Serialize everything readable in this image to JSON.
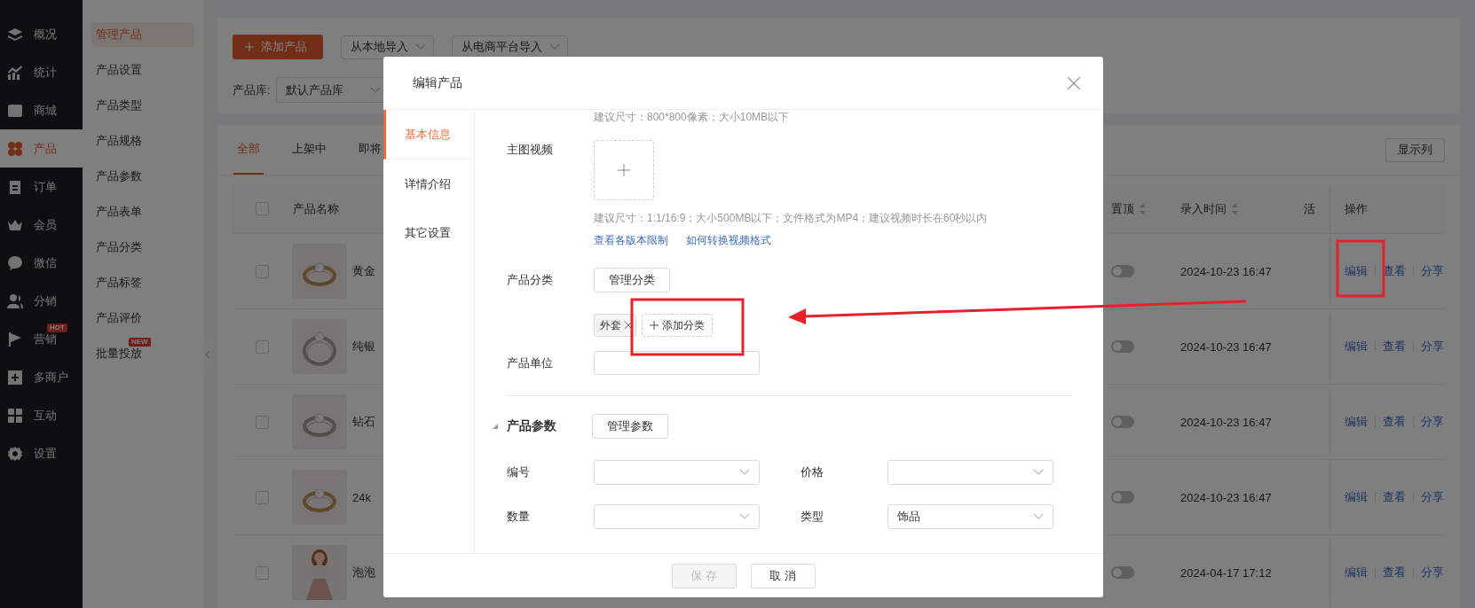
{
  "nav": [
    {
      "label": "概况",
      "selected": false
    },
    {
      "label": "统计",
      "selected": false
    },
    {
      "label": "商城",
      "selected": false
    },
    {
      "label": "产品",
      "selected": true
    },
    {
      "label": "订单",
      "selected": false
    },
    {
      "label": "会员",
      "selected": false
    },
    {
      "label": "微信",
      "selected": false
    },
    {
      "label": "分销",
      "selected": false
    },
    {
      "label": "营销",
      "selected": false,
      "badge": "HOT"
    },
    {
      "label": "多商户",
      "selected": false
    },
    {
      "label": "互动",
      "selected": false
    },
    {
      "label": "设置",
      "selected": false
    }
  ],
  "subnav": [
    {
      "label": "管理产品",
      "selected": true
    },
    {
      "label": "产品设置",
      "selected": false
    },
    {
      "label": "产品类型",
      "selected": false
    },
    {
      "label": "产品规格",
      "selected": false
    },
    {
      "label": "产品参数",
      "selected": false
    },
    {
      "label": "产品表单",
      "selected": false
    },
    {
      "label": "产品分类",
      "selected": false
    },
    {
      "label": "产品标签",
      "selected": false
    },
    {
      "label": "产品评价",
      "selected": false
    },
    {
      "label": "批量投放",
      "selected": false,
      "badge": "NEW"
    }
  ],
  "toolbar": {
    "add_button": "添加产品",
    "import_dropdowns": [
      "从本地导入",
      "从电商平台导入"
    ],
    "filter": {
      "label": "产品库:",
      "value": "默认产品库"
    }
  },
  "tabs": [
    {
      "label": "全部",
      "selected": true
    },
    {
      "label": "上架中",
      "selected": false
    },
    {
      "label": "即将",
      "selected": false
    }
  ],
  "columns_button": "显示列",
  "table": {
    "select_all": {
      "checked": false
    },
    "columns": [
      "产品名称",
      "置顶",
      "录入时间",
      "活",
      "操作"
    ],
    "rows": [
      {
        "checked": false,
        "image": {
          "kind": "picture"
        },
        "name": "黄金",
        "pinned": false,
        "time": "2024-10-23 16:47",
        "actions": [
          "编辑",
          "查看",
          "分享"
        ]
      },
      {
        "checked": false,
        "image": {
          "kind": "picture"
        },
        "name": "纯银",
        "pinned": false,
        "time": "2024-10-23 16:47",
        "actions": [
          "编辑",
          "查看",
          "分享"
        ]
      },
      {
        "checked": false,
        "image": {
          "kind": "picture"
        },
        "name": "钻石",
        "pinned": false,
        "time": "2024-10-23 16:47",
        "actions": [
          "编辑",
          "查看",
          "分享"
        ]
      },
      {
        "checked": false,
        "image": {
          "kind": "picture"
        },
        "name": "24k",
        "pinned": false,
        "time": "2024-10-23 16:47",
        "actions": [
          "编辑",
          "查看",
          "分享"
        ]
      },
      {
        "checked": false,
        "image": {
          "kind": "picture"
        },
        "name": "泡泡",
        "pinned": false,
        "time": "2024-04-17 17:12",
        "actions": [
          "编辑",
          "查看",
          "分享"
        ]
      }
    ]
  },
  "dialog": {
    "title": "编辑产品",
    "tabs": [
      {
        "label": "基本信息",
        "selected": true
      },
      {
        "label": "详情介绍",
        "selected": false
      },
      {
        "label": "其它设置",
        "selected": false
      }
    ],
    "image_hint": "建议尺寸：800*800像素；大小10MB以下",
    "video": {
      "label": "主图视频",
      "hint": "建议尺寸：1:1/16:9；大小500MB以下；文件格式为MP4；建议视频时长在60秒以内",
      "links": [
        "查看各版本限制",
        "如何转换视频格式"
      ]
    },
    "category": {
      "label": "产品分类",
      "button": "管理分类",
      "tags": [
        "外套"
      ],
      "add_tag": "添加分类"
    },
    "unit": {
      "label": "产品单位"
    },
    "params": {
      "title": "产品参数",
      "button": "管理参数",
      "expanded": true,
      "fields": [
        {
          "label": "编号"
        },
        {
          "label": "价格"
        },
        {
          "label": "数量"
        },
        {
          "label": "类型",
          "value": "饰品"
        }
      ]
    },
    "footer": {
      "save": {
        "label": "保 存",
        "disabled": true
      },
      "cancel": "取 消"
    }
  }
}
